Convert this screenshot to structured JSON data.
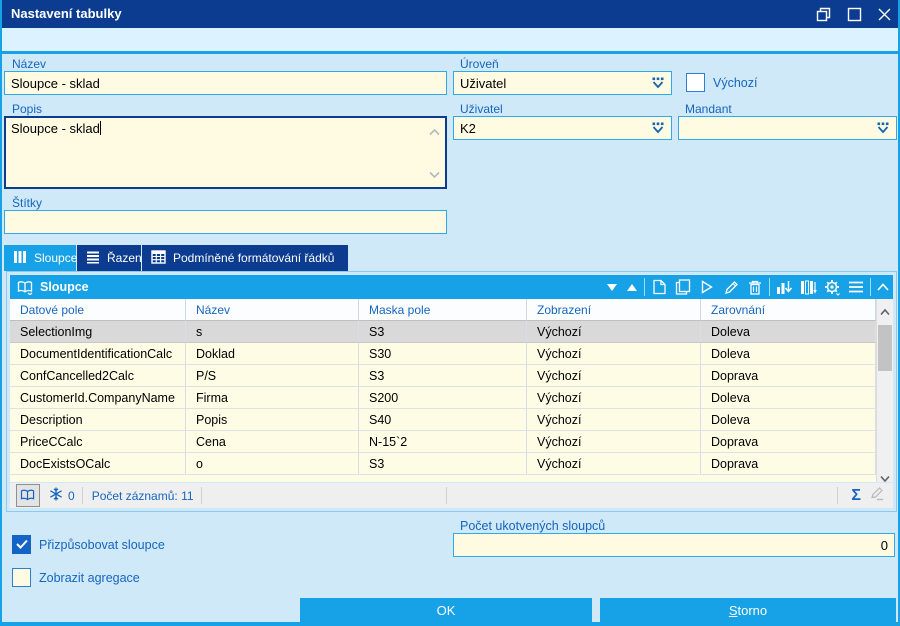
{
  "window": {
    "title": "Nastavení tabulky",
    "controls": [
      "restore",
      "maximize",
      "close"
    ]
  },
  "form": {
    "nazev": {
      "label": "Název",
      "value": "Sloupce - sklad"
    },
    "uroven": {
      "label": "Úroveň",
      "value": "Uživatel"
    },
    "vychozi": {
      "label": "Výchozí",
      "checked": false
    },
    "popis": {
      "label": "Popis",
      "value": "Sloupce - sklad"
    },
    "uzivatel": {
      "label": "Uživatel",
      "value": "K2"
    },
    "mandant": {
      "label": "Mandant",
      "value": ""
    },
    "stitky": {
      "label": "Štítky",
      "value": ""
    }
  },
  "tabs": [
    {
      "label": "Sloupce",
      "icon": "columns-icon",
      "active": true
    },
    {
      "label": "Řazení",
      "icon": "sort-lines-icon",
      "active": false
    },
    {
      "label": "Podmíněné formátování řádků",
      "icon": "table-grid-icon",
      "active": false
    }
  ],
  "panel": {
    "title": "Sloupce",
    "toolbar_icons": [
      "move-down-icon",
      "move-up-icon",
      "new-record-icon",
      "copy-record-icon",
      "run-icon",
      "edit-icon",
      "delete-icon",
      "chart-icon",
      "columns-setup-icon",
      "settings-gear-icon",
      "menu-icon",
      "collapse-panel-icon"
    ],
    "table": {
      "columns": [
        "Datové pole",
        "Název",
        "Maska pole",
        "Zobrazení",
        "Zarovnání"
      ],
      "rows": [
        [
          "SelectionImg",
          "s",
          "S3",
          "Výchozí",
          "Doleva"
        ],
        [
          "DocumentIdentificationCalc",
          "Doklad",
          "S30",
          "Výchozí",
          "Doleva"
        ],
        [
          "ConfCancelled2Calc",
          "P/S",
          "S3",
          "Výchozí",
          "Doprava"
        ],
        [
          "CustomerId.CompanyName",
          "Firma",
          "S200",
          "Výchozí",
          "Doleva"
        ],
        [
          "Description",
          "Popis",
          "S40",
          "Výchozí",
          "Doleva"
        ],
        [
          "PriceCCalc",
          "Cena",
          "N-15`2",
          "Výchozí",
          "Doprava"
        ],
        [
          "DocExistsOCalc",
          "o",
          "S3",
          "Výchozí",
          "Doprava"
        ]
      ],
      "selected_row": 0
    },
    "status": {
      "flake_count": "0",
      "records_label": "Počet záznamů: 11",
      "sigma": "Σ"
    }
  },
  "options": {
    "fit_columns": {
      "label": "Přizpůsobovat sloupce",
      "checked": true
    },
    "aggregations": {
      "label": "Zobrazit agregace",
      "checked": false
    },
    "anchored": {
      "label": "Počet ukotvených sloupců",
      "value": "0"
    }
  },
  "buttons": {
    "ok": "OK",
    "storno": "Storno"
  },
  "colors": {
    "titlebar_blue": "#0c3c90",
    "accent_blue": "#17a2e8",
    "label_blue": "#1565c0",
    "input_cream": "#fffbe2",
    "row_cream": "#fffce6",
    "selected_gray": "#d9d9d9"
  }
}
